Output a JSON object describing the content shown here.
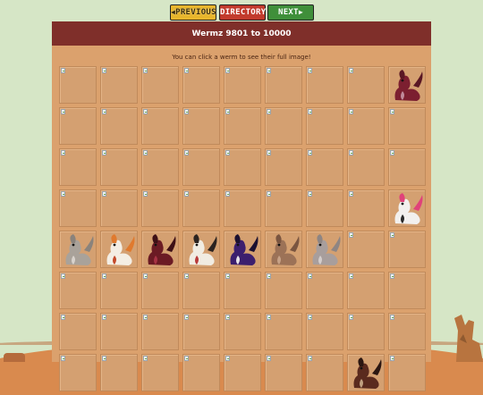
{
  "nav": {
    "previous_label": "PREVIOUS",
    "directory_label": "DIRECTORY",
    "next_label": "NEXT"
  },
  "header": {
    "title": "Wermz 9801 to 10000"
  },
  "hint": "You can click a werm to see their full image!",
  "grid": {
    "columns": 9,
    "visible_rows": 8,
    "werm_thumbnails": [
      {
        "row": 1,
        "col": 9,
        "colors": [
          "#7c1f30",
          "#5a1724",
          "#c08a9a"
        ]
      },
      {
        "row": 4,
        "col": 9,
        "colors": [
          "#f2f0ee",
          "#e0427a",
          "#2a2a2a"
        ]
      },
      {
        "row": 5,
        "col": 1,
        "colors": [
          "#a9a29a",
          "#8a837c",
          "#d8d2cc"
        ]
      },
      {
        "row": 5,
        "col": 2,
        "colors": [
          "#f4eee4",
          "#e07a2e",
          "#c44a2a"
        ]
      },
      {
        "row": 5,
        "col": 3,
        "colors": [
          "#6b1b24",
          "#3d1016",
          "#a63344"
        ]
      },
      {
        "row": 5,
        "col": 4,
        "colors": [
          "#f1ece2",
          "#2b2320",
          "#b83a3a"
        ]
      },
      {
        "row": 5,
        "col": 5,
        "colors": [
          "#3c1f6e",
          "#1b1030",
          "#e8e4ea"
        ]
      },
      {
        "row": 5,
        "col": 6,
        "colors": [
          "#9c7257",
          "#7a5540",
          "#c7a287"
        ]
      },
      {
        "row": 5,
        "col": 7,
        "colors": [
          "#a89e9c",
          "#8e8583",
          "#d4cdcb"
        ]
      },
      {
        "row": 8,
        "col": 8,
        "colors": [
          "#5a2a1e",
          "#2b1611",
          "#c0a080"
        ]
      }
    ]
  }
}
